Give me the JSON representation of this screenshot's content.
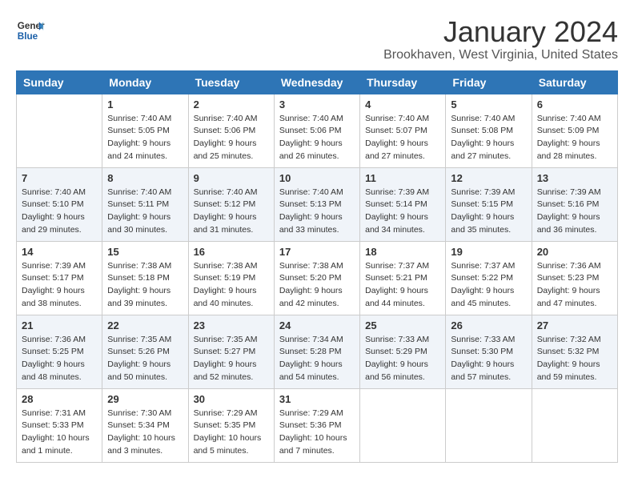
{
  "header": {
    "logo_line1": "General",
    "logo_line2": "Blue",
    "month": "January 2024",
    "location": "Brookhaven, West Virginia, United States"
  },
  "weekdays": [
    "Sunday",
    "Monday",
    "Tuesday",
    "Wednesday",
    "Thursday",
    "Friday",
    "Saturday"
  ],
  "weeks": [
    [
      {
        "day": "",
        "sunrise": "",
        "sunset": "",
        "daylight": ""
      },
      {
        "day": "1",
        "sunrise": "Sunrise: 7:40 AM",
        "sunset": "Sunset: 5:05 PM",
        "daylight": "Daylight: 9 hours and 24 minutes."
      },
      {
        "day": "2",
        "sunrise": "Sunrise: 7:40 AM",
        "sunset": "Sunset: 5:06 PM",
        "daylight": "Daylight: 9 hours and 25 minutes."
      },
      {
        "day": "3",
        "sunrise": "Sunrise: 7:40 AM",
        "sunset": "Sunset: 5:06 PM",
        "daylight": "Daylight: 9 hours and 26 minutes."
      },
      {
        "day": "4",
        "sunrise": "Sunrise: 7:40 AM",
        "sunset": "Sunset: 5:07 PM",
        "daylight": "Daylight: 9 hours and 27 minutes."
      },
      {
        "day": "5",
        "sunrise": "Sunrise: 7:40 AM",
        "sunset": "Sunset: 5:08 PM",
        "daylight": "Daylight: 9 hours and 27 minutes."
      },
      {
        "day": "6",
        "sunrise": "Sunrise: 7:40 AM",
        "sunset": "Sunset: 5:09 PM",
        "daylight": "Daylight: 9 hours and 28 minutes."
      }
    ],
    [
      {
        "day": "7",
        "sunrise": "Sunrise: 7:40 AM",
        "sunset": "Sunset: 5:10 PM",
        "daylight": "Daylight: 9 hours and 29 minutes."
      },
      {
        "day": "8",
        "sunrise": "Sunrise: 7:40 AM",
        "sunset": "Sunset: 5:11 PM",
        "daylight": "Daylight: 9 hours and 30 minutes."
      },
      {
        "day": "9",
        "sunrise": "Sunrise: 7:40 AM",
        "sunset": "Sunset: 5:12 PM",
        "daylight": "Daylight: 9 hours and 31 minutes."
      },
      {
        "day": "10",
        "sunrise": "Sunrise: 7:40 AM",
        "sunset": "Sunset: 5:13 PM",
        "daylight": "Daylight: 9 hours and 33 minutes."
      },
      {
        "day": "11",
        "sunrise": "Sunrise: 7:39 AM",
        "sunset": "Sunset: 5:14 PM",
        "daylight": "Daylight: 9 hours and 34 minutes."
      },
      {
        "day": "12",
        "sunrise": "Sunrise: 7:39 AM",
        "sunset": "Sunset: 5:15 PM",
        "daylight": "Daylight: 9 hours and 35 minutes."
      },
      {
        "day": "13",
        "sunrise": "Sunrise: 7:39 AM",
        "sunset": "Sunset: 5:16 PM",
        "daylight": "Daylight: 9 hours and 36 minutes."
      }
    ],
    [
      {
        "day": "14",
        "sunrise": "Sunrise: 7:39 AM",
        "sunset": "Sunset: 5:17 PM",
        "daylight": "Daylight: 9 hours and 38 minutes."
      },
      {
        "day": "15",
        "sunrise": "Sunrise: 7:38 AM",
        "sunset": "Sunset: 5:18 PM",
        "daylight": "Daylight: 9 hours and 39 minutes."
      },
      {
        "day": "16",
        "sunrise": "Sunrise: 7:38 AM",
        "sunset": "Sunset: 5:19 PM",
        "daylight": "Daylight: 9 hours and 40 minutes."
      },
      {
        "day": "17",
        "sunrise": "Sunrise: 7:38 AM",
        "sunset": "Sunset: 5:20 PM",
        "daylight": "Daylight: 9 hours and 42 minutes."
      },
      {
        "day": "18",
        "sunrise": "Sunrise: 7:37 AM",
        "sunset": "Sunset: 5:21 PM",
        "daylight": "Daylight: 9 hours and 44 minutes."
      },
      {
        "day": "19",
        "sunrise": "Sunrise: 7:37 AM",
        "sunset": "Sunset: 5:22 PM",
        "daylight": "Daylight: 9 hours and 45 minutes."
      },
      {
        "day": "20",
        "sunrise": "Sunrise: 7:36 AM",
        "sunset": "Sunset: 5:23 PM",
        "daylight": "Daylight: 9 hours and 47 minutes."
      }
    ],
    [
      {
        "day": "21",
        "sunrise": "Sunrise: 7:36 AM",
        "sunset": "Sunset: 5:25 PM",
        "daylight": "Daylight: 9 hours and 48 minutes."
      },
      {
        "day": "22",
        "sunrise": "Sunrise: 7:35 AM",
        "sunset": "Sunset: 5:26 PM",
        "daylight": "Daylight: 9 hours and 50 minutes."
      },
      {
        "day": "23",
        "sunrise": "Sunrise: 7:35 AM",
        "sunset": "Sunset: 5:27 PM",
        "daylight": "Daylight: 9 hours and 52 minutes."
      },
      {
        "day": "24",
        "sunrise": "Sunrise: 7:34 AM",
        "sunset": "Sunset: 5:28 PM",
        "daylight": "Daylight: 9 hours and 54 minutes."
      },
      {
        "day": "25",
        "sunrise": "Sunrise: 7:33 AM",
        "sunset": "Sunset: 5:29 PM",
        "daylight": "Daylight: 9 hours and 56 minutes."
      },
      {
        "day": "26",
        "sunrise": "Sunrise: 7:33 AM",
        "sunset": "Sunset: 5:30 PM",
        "daylight": "Daylight: 9 hours and 57 minutes."
      },
      {
        "day": "27",
        "sunrise": "Sunrise: 7:32 AM",
        "sunset": "Sunset: 5:32 PM",
        "daylight": "Daylight: 9 hours and 59 minutes."
      }
    ],
    [
      {
        "day": "28",
        "sunrise": "Sunrise: 7:31 AM",
        "sunset": "Sunset: 5:33 PM",
        "daylight": "Daylight: 10 hours and 1 minute."
      },
      {
        "day": "29",
        "sunrise": "Sunrise: 7:30 AM",
        "sunset": "Sunset: 5:34 PM",
        "daylight": "Daylight: 10 hours and 3 minutes."
      },
      {
        "day": "30",
        "sunrise": "Sunrise: 7:29 AM",
        "sunset": "Sunset: 5:35 PM",
        "daylight": "Daylight: 10 hours and 5 minutes."
      },
      {
        "day": "31",
        "sunrise": "Sunrise: 7:29 AM",
        "sunset": "Sunset: 5:36 PM",
        "daylight": "Daylight: 10 hours and 7 minutes."
      },
      {
        "day": "",
        "sunrise": "",
        "sunset": "",
        "daylight": ""
      },
      {
        "day": "",
        "sunrise": "",
        "sunset": "",
        "daylight": ""
      },
      {
        "day": "",
        "sunrise": "",
        "sunset": "",
        "daylight": ""
      }
    ]
  ]
}
